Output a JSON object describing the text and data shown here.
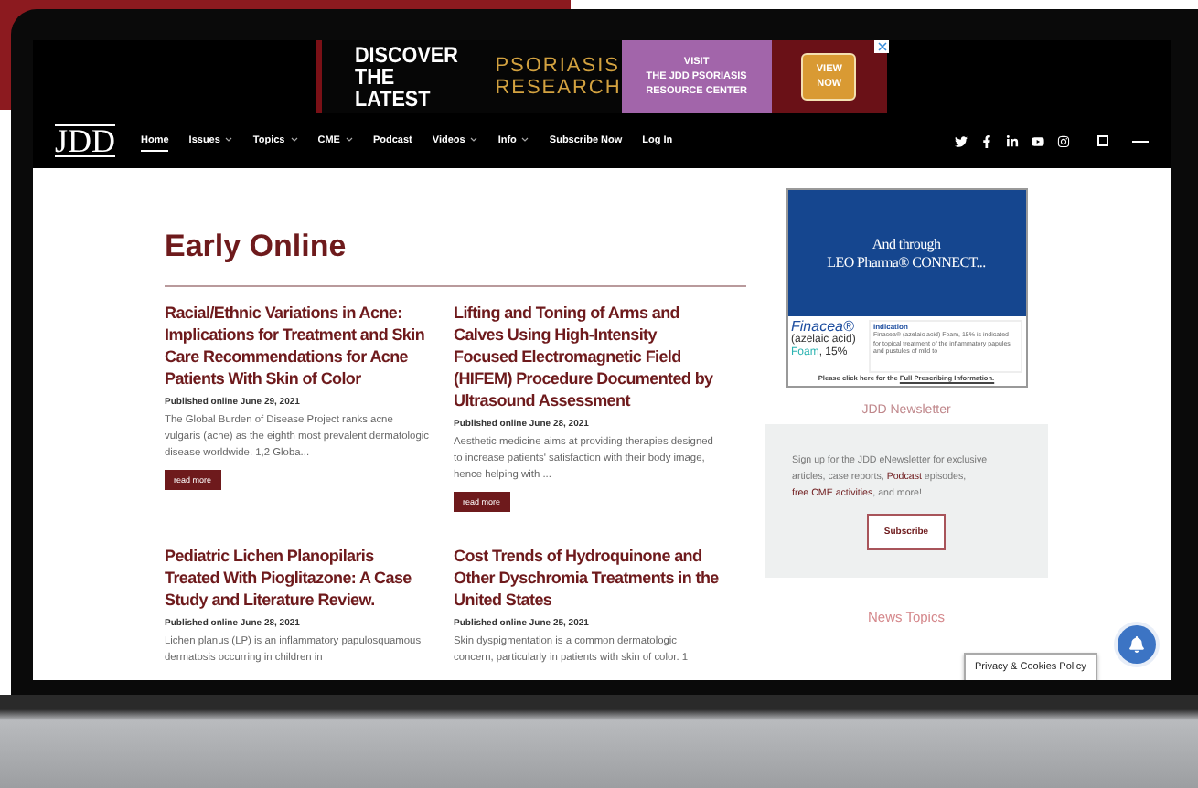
{
  "banner_ad": {
    "headline": [
      "DISCOVER",
      "THE LATEST"
    ],
    "topic": [
      "PSORIASIS",
      "RESEARCH"
    ],
    "visit": [
      "VISIT",
      "THE JDD PSORIASIS",
      "RESOURCE CENTER"
    ],
    "button": [
      "VIEW",
      "NOW"
    ]
  },
  "nav": {
    "logo": "JDD",
    "items": [
      {
        "label": "Home",
        "selected": true,
        "dropdown": false
      },
      {
        "label": "Issues",
        "selected": false,
        "dropdown": true
      },
      {
        "label": "Topics",
        "selected": false,
        "dropdown": true
      },
      {
        "label": "CME",
        "selected": false,
        "dropdown": true
      },
      {
        "label": "Podcast",
        "selected": false,
        "dropdown": false
      },
      {
        "label": "Videos",
        "selected": false,
        "dropdown": true
      },
      {
        "label": "Info",
        "selected": false,
        "dropdown": true
      },
      {
        "label": "Subscribe Now",
        "selected": false,
        "dropdown": false
      },
      {
        "label": "Log In",
        "selected": false,
        "dropdown": false
      }
    ]
  },
  "section_title": "Early Online",
  "articles": [
    {
      "title": "Racial/Ethnic Variations in Acne: Implications for Treatment and Skin Care Recommendations for Acne Patients With Skin of Color",
      "date": "Published online June 29, 2021",
      "excerpt": "The Global Burden of Disease Project ranks acne vulgaris (acne) as the eighth most prevalent dermatologic disease worldwide. 1,2 Globa...",
      "button": "read more"
    },
    {
      "title": "Lifting and Toning of Arms and Calves Using High-Intensity Focused Electromagnetic Field (HIFEM) Procedure Documented by Ultrasound Assessment",
      "date": "Published online June 28, 2021",
      "excerpt": "Aesthetic medicine aims at providing therapies designed to increase patients' satisfaction with their body image, hence helping with ...",
      "button": "read more"
    },
    {
      "title": "Pediatric Lichen Planopilaris Treated With Pioglitazone: A Case Study and Literature Review.",
      "date": "Published online June 28, 2021",
      "excerpt": "Lichen planus (LP) is an inflammatory papulosquamous dermatosis occurring in children in"
    },
    {
      "title": "Cost Trends of Hydroquinone and Other Dyschromia Treatments in the United States",
      "date": "Published online June 25, 2021",
      "excerpt": "Skin dyspigmentation is a common dermatologic concern, particularly in patients with skin of color. 1"
    }
  ],
  "side_ad": {
    "headline": [
      "And through",
      "LEO Pharma® CONNECT..."
    ],
    "brand": "Finacea®",
    "generic": "(azelaic acid)",
    "form": [
      "Foam",
      ", 15%"
    ],
    "indication_title": "Indication",
    "indication": "Finacea® (azelaic acid) Foam, 15% is indicated for topical treatment of the inflammatory papules and pustules of mild to",
    "footer": "Please click here for the",
    "footer_link": "Full Prescribing Information."
  },
  "newsletter": {
    "title": "JDD Newsletter",
    "text": [
      {
        "text": "Sign up for the JDD eNewsletter for exclusive articles, case reports, ",
        "link": false
      },
      {
        "text": "Podcast",
        "link": true
      },
      {
        "text": " episodes, ",
        "link": false
      },
      {
        "text": "free CME activities",
        "link": true
      },
      {
        "text": ", and more!",
        "link": false
      }
    ],
    "button": "Subscribe"
  },
  "news_topics_title": "News Topics",
  "privacy_badge": "Privacy & Cookies Policy"
}
